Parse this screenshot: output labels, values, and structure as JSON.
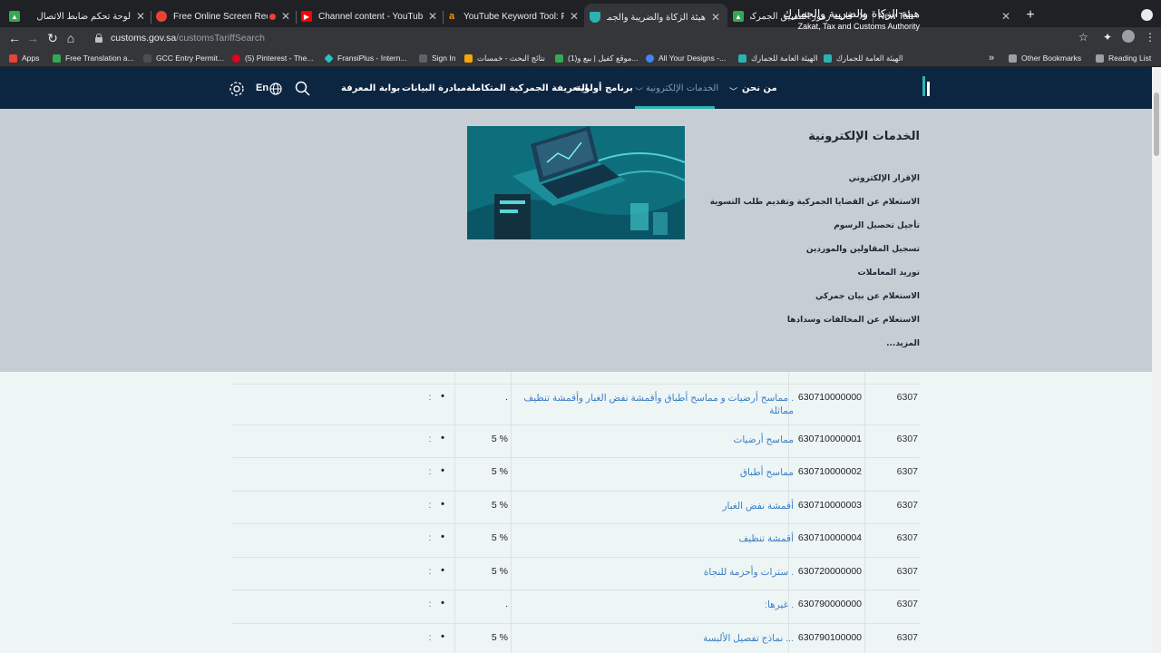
{
  "browser": {
    "tabs": [
      {
        "title": "لوحة تحكم ضابط الاتصال",
        "color": "#34a853",
        "active": false
      },
      {
        "title": "Free Online Screen Record...",
        "color": "#ea4335",
        "active": false
      },
      {
        "title": "Channel content - YouTube Stu...",
        "color": "#ff0000",
        "active": false
      },
      {
        "title": "YouTube Keyword Tool: Find Yo...",
        "color": "#f29900",
        "active": false
      },
      {
        "title": "هيئة الزكاة والضريبة والجمارك",
        "color": "#2bb3b3",
        "active": true
      },
      {
        "title": "قائمة رموز التنسيق الجمركي",
        "color": "#34a853",
        "active": false
      },
      {
        "title": "New Tab",
        "color": "",
        "active": false
      }
    ],
    "url_host": "customs.gov.sa",
    "url_path": "/customsTariffSearch",
    "bookmarks": [
      {
        "label": "Apps",
        "color": "#ea4335"
      },
      {
        "label": "Free Translation a...",
        "color": "#34a853"
      },
      {
        "label": "GCC Entry Permit...",
        "color": "#e8eaed"
      },
      {
        "label": "(5) Pinterest - The...",
        "color": "#e60023"
      },
      {
        "label": "FransiPlus - Intern...",
        "color": "#27c4c4"
      },
      {
        "label": "Sign In",
        "color": "#e8eaed"
      },
      {
        "label": "نتائج البحث - خمسات",
        "color": "#f6a609"
      },
      {
        "label": "(1)موقع كفيل | بيع و...",
        "color": "#34a853"
      },
      {
        "label": "All Your Designs -...",
        "color": "#4285f4"
      },
      {
        "label": "الهيئة العامة للجمارك",
        "color": "#2bb3b3"
      },
      {
        "label": "الهيئة العامة للجمارك",
        "color": "#2bb3b3"
      }
    ],
    "bookmarks_more": "»",
    "other_bookmarks": "Other Bookmarks",
    "reading_list": "Reading List"
  },
  "site": {
    "brand_ar": "هيئة الزكاة والضريبة والجمارك",
    "brand_en": "Zakat, Tax and Customs Authority",
    "nav": [
      {
        "label": "من نحن",
        "active": false
      },
      {
        "label": "الخدمات الإلكترونية",
        "active": true
      },
      {
        "label": "برنامج أولوية",
        "active": false
      },
      {
        "label": "التعريفة الجمركية المتكاملة",
        "active": false
      },
      {
        "label": "مبادرة البيانات",
        "active": false
      },
      {
        "label": "بوابة المعرفة",
        "active": false
      }
    ],
    "lang_label": "En",
    "accent": "#2bb3b3",
    "header_bg": "#0c2540"
  },
  "mega_menu": {
    "title": "الخدمات الإلكترونية",
    "links": [
      "الإقرار الإلكتروني",
      "الاستعلام عن القضايا الجمركية وتقديم طلب التسوية",
      "تأجيل تحصيل الرسوم",
      "تسجيل المقاولين والموردين",
      "توريد المعاملات",
      "الاستعلام عن بيان جمركي",
      "الاستعلام عن المخالفات وسدادها",
      "المزيد..."
    ]
  },
  "tariff_rows": [
    {
      "heading": "6307",
      "code": "630710000000",
      "desc": ". مماسح أرضيات و مماسح أطباق وأقمشة نفض الغبار وأقمشة تنظيف مماثلة",
      "duty": ".",
      "dot": "•",
      "colon": ":"
    },
    {
      "heading": "6307",
      "code": "630710000001",
      "desc": "مماسح أرضيات",
      "duty": "5 %",
      "dot": "•",
      "colon": ":"
    },
    {
      "heading": "6307",
      "code": "630710000002",
      "desc": "مماسح أطباق",
      "duty": "5 %",
      "dot": "•",
      "colon": ":"
    },
    {
      "heading": "6307",
      "code": "630710000003",
      "desc": "أقمشة نفض الغبار",
      "duty": "5 %",
      "dot": "•",
      "colon": ":"
    },
    {
      "heading": "6307",
      "code": "630710000004",
      "desc": "أقمشة تنظيف",
      "duty": "5 %",
      "dot": "•",
      "colon": ":"
    },
    {
      "heading": "6307",
      "code": "630720000000",
      "desc": ". سترات وأحزمة للنجاة",
      "duty": "5 %",
      "dot": "•",
      "colon": ":"
    },
    {
      "heading": "6307",
      "code": "630790000000",
      "desc": ". غيرها:",
      "duty": ".",
      "dot": "•",
      "colon": ":"
    },
    {
      "heading": "6307",
      "code": "630790100000",
      "desc": "... نماذج تفصيل الألبسة",
      "duty": "5 %",
      "dot": "•",
      "colon": ":"
    }
  ]
}
